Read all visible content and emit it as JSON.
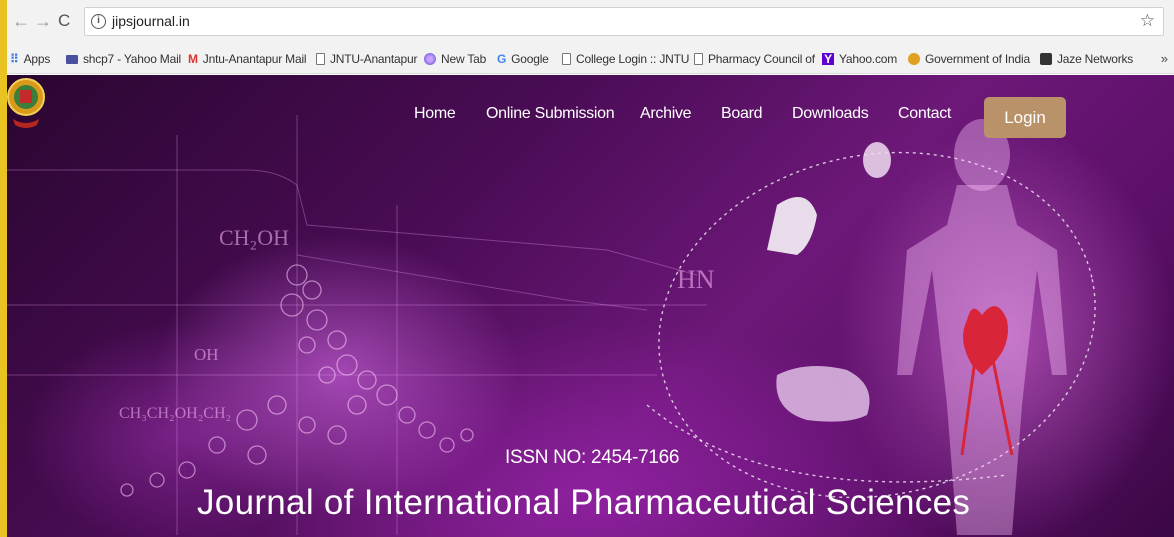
{
  "browser": {
    "url": "jipsjournal.in",
    "bookmarks": [
      {
        "label": "Apps",
        "icon": "apps-grid-icon"
      },
      {
        "label": "shcp7 - Yahoo Mail",
        "icon": "yahoo-mail-icon"
      },
      {
        "label": "Jntu-Anantapur Mail",
        "icon": "gmail-icon"
      },
      {
        "label": "JNTU-Anantapur",
        "icon": "page-icon"
      },
      {
        "label": "New Tab",
        "icon": "new-tab-icon"
      },
      {
        "label": "Google",
        "icon": "google-icon"
      },
      {
        "label": "College Login :: JNTU",
        "icon": "page-icon"
      },
      {
        "label": "Pharmacy Council of",
        "icon": "page-icon"
      },
      {
        "label": "Yahoo.com",
        "icon": "yahoo-icon"
      },
      {
        "label": "Government of India",
        "icon": "government-icon"
      },
      {
        "label": "Jaze Networks",
        "icon": "jaze-icon"
      }
    ],
    "more": "»"
  },
  "site": {
    "nav": [
      {
        "label": "Home"
      },
      {
        "label": "Online Submission"
      },
      {
        "label": "Archive"
      },
      {
        "label": "Board"
      },
      {
        "label": "Downloads"
      },
      {
        "label": "Contact"
      }
    ],
    "login_label": "Login",
    "issn": "ISSN NO: 2454-7166",
    "title": "Journal of International Pharmaceutical Sciences",
    "background_labels": {
      "ch2oh": "CH₂OH",
      "hn": "HN",
      "oh": "OH",
      "chain": "CH₃CH₂OH₂CH₂"
    }
  },
  "colors": {
    "accent_login": "#b9926a",
    "hero_base": "#4a0c55",
    "left_edge": "#e8c321"
  }
}
